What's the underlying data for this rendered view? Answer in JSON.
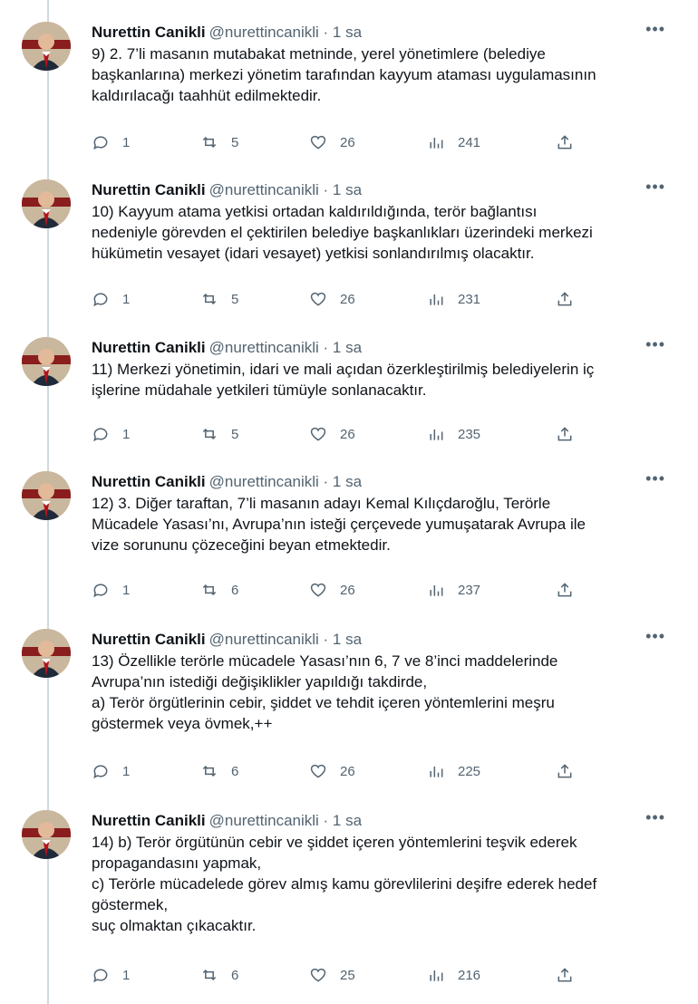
{
  "tweets": [
    {
      "name": "Nurettin Canikli",
      "handle": "@nurettincanikli · 1 sa",
      "text": "9) 2. 7’li masanın mutabakat metninde, yerel yönetimlere (belediye\nbaşkanlarına) merkezi yönetim tarafından kayyum ataması uygulamasının\nkaldırılacağı taahhüt edilmektedir.",
      "replies": "1",
      "retweets": "5",
      "likes": "26",
      "views": "241"
    },
    {
      "name": "Nurettin Canikli",
      "handle": "@nurettincanikli · 1 sa",
      "text": "10) Kayyum atama yetkisi ortadan kaldırıldığında, terör bağlantısı\nnedeniyle görevden el çektirilen belediye başkanlıkları üzerindeki merkezi\nhükümetin vesayet (idari vesayet) yetkisi sonlandırılmış olacaktır.",
      "replies": "1",
      "retweets": "5",
      "likes": "26",
      "views": "231"
    },
    {
      "name": "Nurettin Canikli",
      "handle": "@nurettincanikli · 1 sa",
      "text": "11) Merkezi yönetimin, idari ve mali açıdan özerkleştirilmiş belediyelerin iç\nişlerine müdahale yetkileri tümüyle sonlanacaktır.",
      "replies": "1",
      "retweets": "5",
      "likes": "26",
      "views": "235"
    },
    {
      "name": "Nurettin Canikli",
      "handle": "@nurettincanikli · 1 sa",
      "text": "12) 3. Diğer taraftan, 7’li masanın adayı Kemal Kılıçdaroğlu, Terörle\nMücadele Yasası’nı, Avrupa’nın isteği çerçevede yumuşatarak Avrupa ile\nvize sorununu çözeceğini beyan etmektedir.",
      "replies": "1",
      "retweets": "6",
      "likes": "26",
      "views": "237"
    },
    {
      "name": "Nurettin Canikli",
      "handle": "@nurettincanikli · 1 sa",
      "text": "13) Özellikle terörle mücadele Yasası’nın 6, 7 ve 8’inci maddelerinde\nAvrupa’nın istediği değişiklikler yapıldığı takdirde,\na) Terör örgütlerinin cebir, şiddet ve tehdit içeren yöntemlerini meşru\ngöstermek veya övmek,++",
      "replies": "1",
      "retweets": "6",
      "likes": "26",
      "views": "225"
    },
    {
      "name": "Nurettin Canikli",
      "handle": "@nurettincanikli · 1 sa",
      "text": "14) b) Terör örgütünün cebir ve şiddet içeren yöntemlerini teşvik ederek\npropagandasını yapmak,\nc) Terörle mücadelede görev almış kamu görevlilerini deşifre ederek hedef\ngöstermek,\nsuç olmaktan çıkacaktır.",
      "replies": "1",
      "retweets": "6",
      "likes": "25",
      "views": "216"
    }
  ]
}
